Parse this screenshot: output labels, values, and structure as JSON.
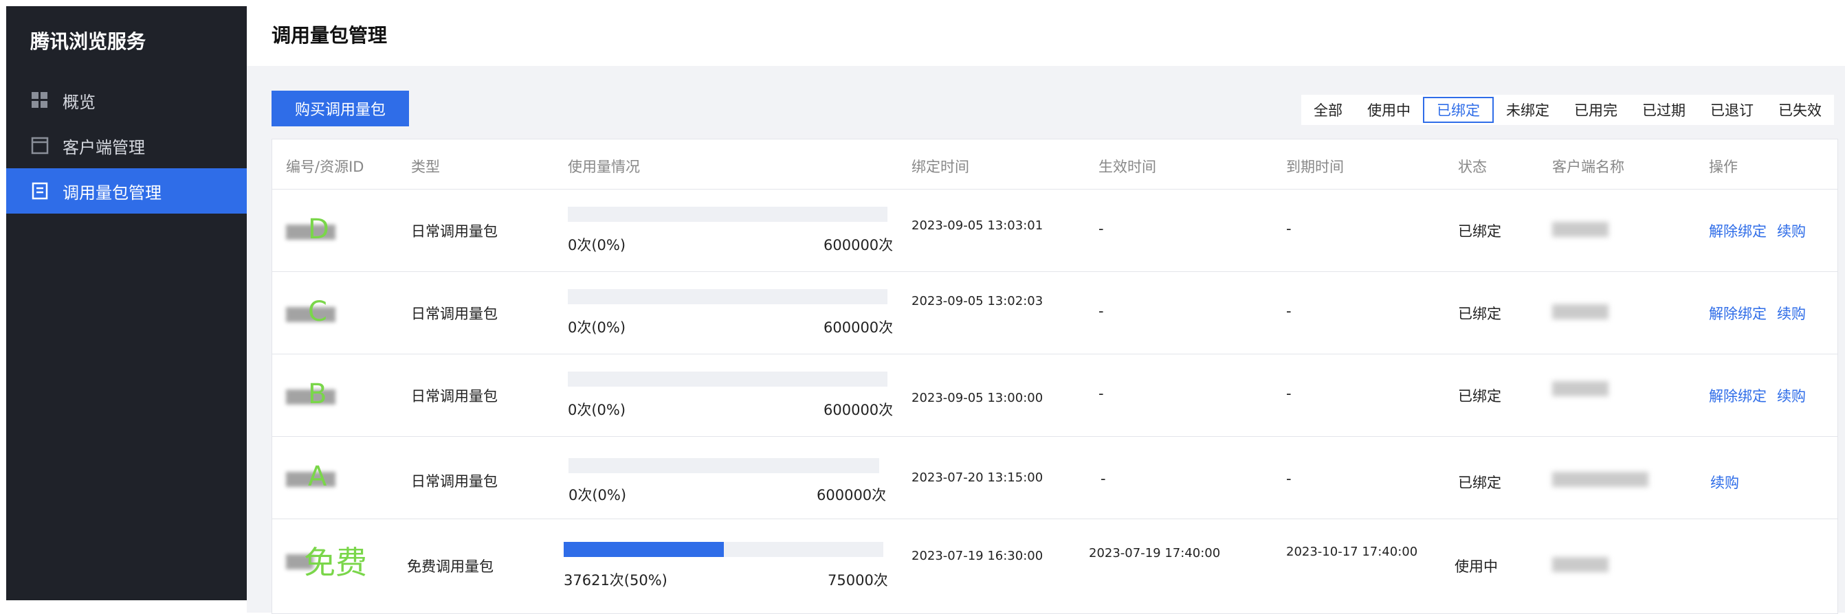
{
  "app": {
    "brand": "腾讯浏览服务"
  },
  "sidebar": {
    "items": [
      {
        "label": "概览",
        "icon": "dashboard-grid-icon"
      },
      {
        "label": "客户端管理",
        "icon": "window-icon"
      },
      {
        "label": "调用量包管理",
        "icon": "document-list-icon",
        "active": true
      }
    ]
  },
  "page": {
    "title": "调用量包管理"
  },
  "toolbar": {
    "buy_label": "购买调用量包"
  },
  "filters": [
    {
      "label": "全部"
    },
    {
      "label": "使用中"
    },
    {
      "label": "已绑定",
      "active": true
    },
    {
      "label": "未绑定"
    },
    {
      "label": "已用完"
    },
    {
      "label": "已过期"
    },
    {
      "label": "已退订"
    },
    {
      "label": "已失效"
    }
  ],
  "table": {
    "headers": [
      "编号/资源ID",
      "类型",
      "使用量情况",
      "绑定时间",
      "生效时间",
      "到期时间",
      "状态",
      "客户端名称",
      "操作"
    ],
    "rows": [
      {
        "overlay": "D",
        "type": "日常调用量包",
        "used": "0次(0%)",
        "total": "600000次",
        "percent": 0,
        "bind_time": "2023-09-05 13:03:01",
        "effective_time": "-",
        "expire_time": "-",
        "status": "已绑定",
        "actions": [
          "解除绑定",
          "续购"
        ]
      },
      {
        "overlay": "C",
        "type": "日常调用量包",
        "used": "0次(0%)",
        "total": "600000次",
        "percent": 0,
        "bind_time": "2023-09-05 13:02:03",
        "effective_time": "-",
        "expire_time": "-",
        "status": "已绑定",
        "actions": [
          "解除绑定",
          "续购"
        ]
      },
      {
        "overlay": "B",
        "type": "日常调用量包",
        "used": "0次(0%)",
        "total": "600000次",
        "percent": 0,
        "bind_time": "2023-09-05 13:00:00",
        "effective_time": "-",
        "expire_time": "-",
        "status": "已绑定",
        "actions": [
          "解除绑定",
          "续购"
        ]
      },
      {
        "overlay": "A",
        "type": "日常调用量包",
        "used": "0次(0%)",
        "total": "600000次",
        "percent": 0,
        "bind_time": "2023-07-20 13:15:00",
        "effective_time": "-",
        "expire_time": "-",
        "status": "已绑定",
        "actions": [
          "续购"
        ]
      },
      {
        "overlay": "免费",
        "type": "免费调用量包",
        "used": "37621次(50%)",
        "total": "75000次",
        "percent": 50,
        "bind_time": "2023-07-19 16:30:00",
        "effective_time": "2023-07-19 17:40:00",
        "expire_time": "2023-10-17 17:40:00",
        "status": "使用中",
        "actions": []
      }
    ]
  },
  "colors": {
    "accent": "#2f6de8",
    "sidebar_bg": "#1f2229",
    "overlay_green": "#7ad64a"
  }
}
